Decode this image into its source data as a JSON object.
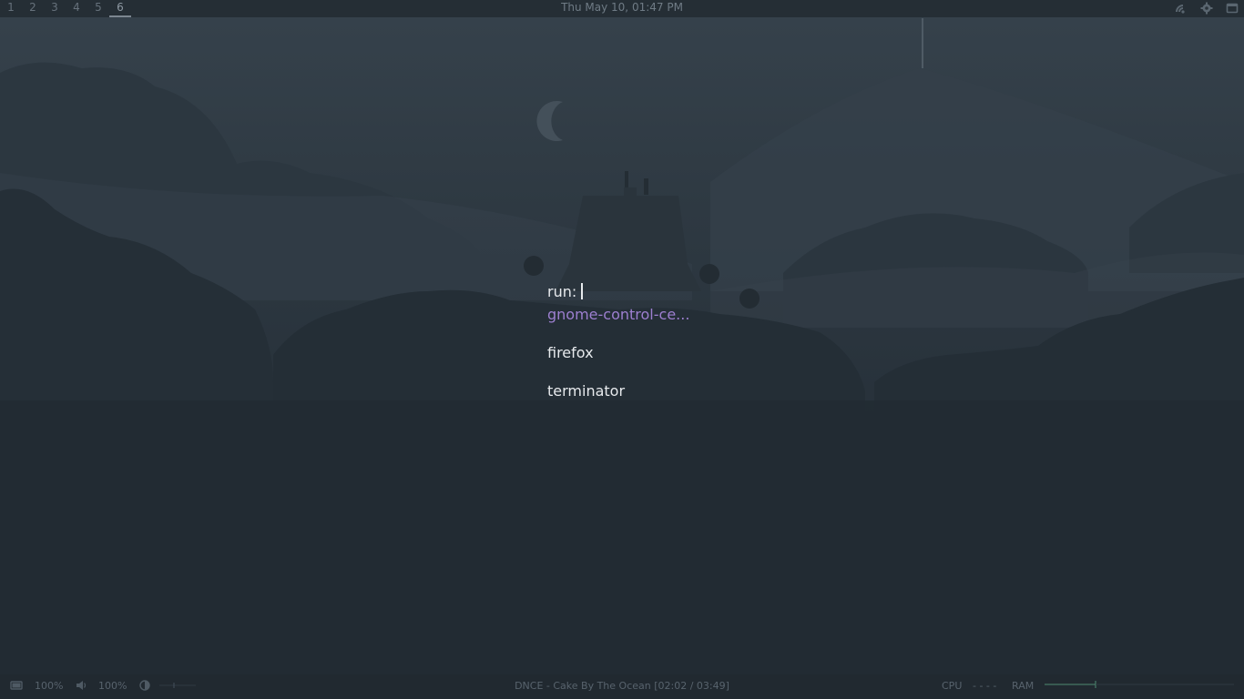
{
  "topbar": {
    "workspaces": [
      {
        "label": "1"
      },
      {
        "label": "2"
      },
      {
        "label": "3"
      },
      {
        "label": "4"
      },
      {
        "label": "5"
      },
      {
        "label": "6"
      }
    ],
    "active_workspace": "6",
    "clock": "Thu May 10, 01:47 PM",
    "tray_icons": [
      "network-icon",
      "settings-icon",
      "window-icon"
    ]
  },
  "launcher": {
    "prompt": "run:",
    "input_value": "",
    "entries": [
      {
        "label": "gnome-control-ce...",
        "selected": true
      },
      {
        "label": "firefox",
        "selected": false
      },
      {
        "label": "terminator",
        "selected": false
      }
    ]
  },
  "bottombar": {
    "battery_value": "100%",
    "volume_value": "100%",
    "now_playing": "DNCE  -  Cake By The Ocean [02:02 / 03:49]",
    "cpu_label": "CPU",
    "cpu_value": "- - - -",
    "ram_label": "RAM"
  },
  "colors": {
    "accent": "#9d7fd0",
    "text": "#e7eaed",
    "bar_text": "#58636d",
    "ram_graph": "#4f8a72"
  }
}
